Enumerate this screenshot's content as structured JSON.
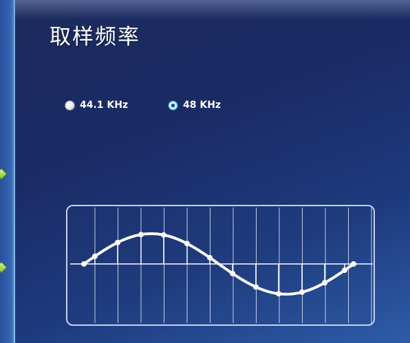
{
  "title": "取样频率",
  "options": [
    {
      "label": "44.1 KHz",
      "selected": false
    },
    {
      "label": "48 KHz",
      "selected": true
    }
  ],
  "colors": {
    "background": "#1c2b5e",
    "text": "#ffffff",
    "grid": "#dfe8f7",
    "accent": "#1e90d6"
  },
  "icons": {
    "sidebar_markers": "green-diamond-icon",
    "radio": "radio-button-icon"
  }
}
